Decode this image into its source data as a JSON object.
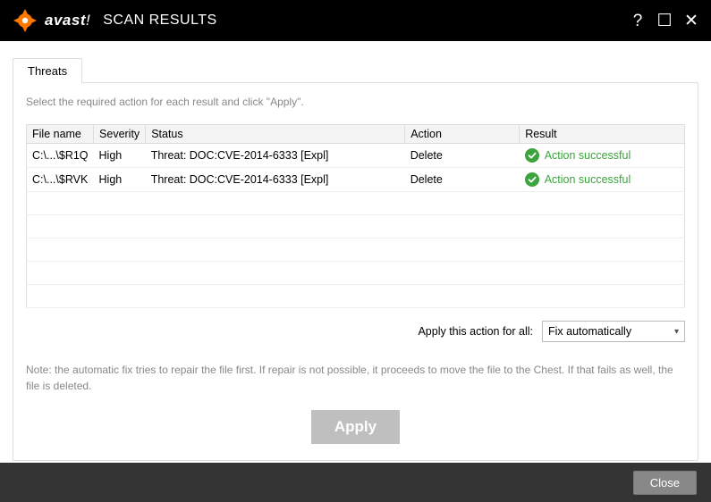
{
  "brand": {
    "name_bold": "avast",
    "name_excl": "!"
  },
  "window_title": "SCAN RESULTS",
  "controls": {
    "help": "?",
    "maximize": "☐",
    "close": "✕"
  },
  "tab_label": "Threats",
  "instruction": "Select the required action for each result and click \"Apply\".",
  "columns": {
    "file": "File name",
    "severity": "Severity",
    "status": "Status",
    "action": "Action",
    "result": "Result"
  },
  "rows": [
    {
      "file": "C:\\...\\$R1Q",
      "severity": "High",
      "status": "Threat: DOC:CVE-2014-6333 [Expl]",
      "action": "Delete",
      "result": "Action successful"
    },
    {
      "file": "C:\\...\\$RVK",
      "severity": "High",
      "status": "Threat: DOC:CVE-2014-6333 [Expl]",
      "action": "Delete",
      "result": "Action successful"
    }
  ],
  "apply_all_label": "Apply this action for all:",
  "apply_all_value": "Fix automatically",
  "note": "Note: the automatic fix tries to repair the file first. If repair is not possible, it proceeds to move the file to the Chest. If that fails as well, the file is deleted.",
  "apply_button": "Apply",
  "footer_close": "Close",
  "colors": {
    "brand_orange": "#ff7800",
    "success_green": "#3da33d"
  }
}
